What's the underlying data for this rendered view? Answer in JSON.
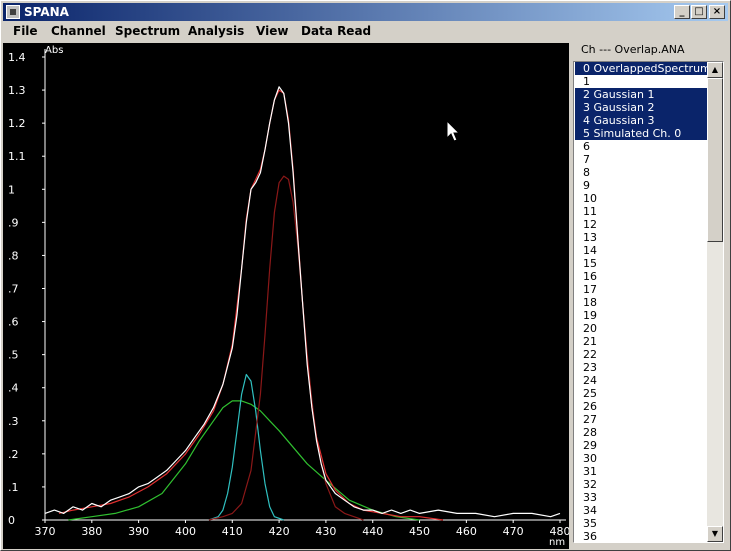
{
  "window": {
    "title": "SPANA"
  },
  "menu": [
    "File",
    "Channel",
    "Spectrum",
    "Analysis",
    "View",
    "Data Read"
  ],
  "title_buttons": {
    "minimize": "_",
    "maximize": "□",
    "close": "×"
  },
  "panel": {
    "label": "Ch --- Overlap.ANA",
    "items": [
      {
        "label": "0 OverlappedSpectrum",
        "selected": true
      },
      {
        "label": "1",
        "selected": false
      },
      {
        "label": "2 Gaussian 1",
        "selected": true
      },
      {
        "label": "3 Gaussian 2",
        "selected": true
      },
      {
        "label": "4 Gaussian 3",
        "selected": true
      },
      {
        "label": "5 Simulated Ch. 0",
        "selected": true
      },
      {
        "label": "6",
        "selected": false
      },
      {
        "label": "7",
        "selected": false
      },
      {
        "label": "8",
        "selected": false
      },
      {
        "label": "9",
        "selected": false
      },
      {
        "label": "10",
        "selected": false
      },
      {
        "label": "11",
        "selected": false
      },
      {
        "label": "12",
        "selected": false
      },
      {
        "label": "13",
        "selected": false
      },
      {
        "label": "14",
        "selected": false
      },
      {
        "label": "15",
        "selected": false
      },
      {
        "label": "16",
        "selected": false
      },
      {
        "label": "17",
        "selected": false
      },
      {
        "label": "18",
        "selected": false
      },
      {
        "label": "19",
        "selected": false
      },
      {
        "label": "20",
        "selected": false
      },
      {
        "label": "21",
        "selected": false
      },
      {
        "label": "22",
        "selected": false
      },
      {
        "label": "23",
        "selected": false
      },
      {
        "label": "24",
        "selected": false
      },
      {
        "label": "25",
        "selected": false
      },
      {
        "label": "26",
        "selected": false
      },
      {
        "label": "27",
        "selected": false
      },
      {
        "label": "28",
        "selected": false
      },
      {
        "label": "29",
        "selected": false
      },
      {
        "label": "30",
        "selected": false
      },
      {
        "label": "31",
        "selected": false
      },
      {
        "label": "32",
        "selected": false
      },
      {
        "label": "33",
        "selected": false
      },
      {
        "label": "34",
        "selected": false
      },
      {
        "label": "35",
        "selected": false
      },
      {
        "label": "36",
        "selected": false
      }
    ]
  },
  "chart_data": {
    "type": "line",
    "ylabel": "Abs",
    "xlabel": "nm",
    "xlim": [
      370,
      480
    ],
    "ylim": [
      0,
      1.4
    ],
    "xticks": [
      370,
      380,
      390,
      400,
      410,
      420,
      430,
      440,
      450,
      460,
      470,
      480
    ],
    "yticks": [
      {
        "v": 0,
        "label": "0"
      },
      {
        "v": 0.1,
        "label": ".1"
      },
      {
        "v": 0.2,
        "label": ".2"
      },
      {
        "v": 0.3,
        "label": ".3"
      },
      {
        "v": 0.4,
        "label": ".4"
      },
      {
        "v": 0.5,
        "label": ".5"
      },
      {
        "v": 0.6,
        "label": ".6"
      },
      {
        "v": 0.7,
        "label": ".7"
      },
      {
        "v": 0.8,
        "label": ".8"
      },
      {
        "v": 0.9,
        "label": ".9"
      },
      {
        "v": 1.0,
        "label": "1"
      },
      {
        "v": 1.1,
        "label": "1.1"
      },
      {
        "v": 1.2,
        "label": "1.2"
      },
      {
        "v": 1.3,
        "label": "1.3"
      },
      {
        "v": 1.4,
        "label": "1.4"
      }
    ],
    "series": [
      {
        "color": "#ffffff",
        "x": [
          370,
          372,
          374,
          376,
          378,
          380,
          382,
          384,
          386,
          388,
          390,
          392,
          394,
          396,
          398,
          400,
          402,
          404,
          406,
          408,
          410,
          411,
          412,
          413,
          414,
          415,
          416,
          417,
          418,
          419,
          420,
          421,
          422,
          423,
          424,
          425,
          426,
          427,
          428,
          429,
          430,
          432,
          434,
          436,
          438,
          440,
          442,
          444,
          446,
          448,
          450,
          454,
          458,
          462,
          466,
          470,
          474,
          478,
          480
        ],
        "y": [
          0.02,
          0.03,
          0.02,
          0.04,
          0.03,
          0.05,
          0.04,
          0.06,
          0.07,
          0.08,
          0.1,
          0.11,
          0.13,
          0.15,
          0.18,
          0.21,
          0.25,
          0.29,
          0.34,
          0.41,
          0.52,
          0.62,
          0.76,
          0.9,
          1.0,
          1.02,
          1.05,
          1.12,
          1.2,
          1.27,
          1.31,
          1.29,
          1.2,
          1.05,
          0.85,
          0.66,
          0.47,
          0.34,
          0.24,
          0.17,
          0.12,
          0.08,
          0.06,
          0.04,
          0.03,
          0.03,
          0.02,
          0.03,
          0.02,
          0.03,
          0.02,
          0.03,
          0.02,
          0.02,
          0.01,
          0.02,
          0.02,
          0.01,
          0.02
        ]
      },
      {
        "color": "#e03030",
        "x": [
          373,
          376,
          380,
          384,
          388,
          392,
          396,
          400,
          403,
          406,
          408,
          410,
          412,
          413,
          414,
          415,
          416,
          417,
          418,
          419,
          420,
          421,
          422,
          423,
          424,
          425,
          426,
          427,
          428,
          430,
          432,
          435,
          438,
          442,
          446,
          450,
          455
        ],
        "y": [
          0.02,
          0.03,
          0.04,
          0.05,
          0.07,
          0.1,
          0.14,
          0.2,
          0.26,
          0.33,
          0.41,
          0.53,
          0.76,
          0.91,
          1.0,
          1.03,
          1.06,
          1.12,
          1.2,
          1.27,
          1.3,
          1.29,
          1.21,
          1.06,
          0.86,
          0.66,
          0.48,
          0.34,
          0.25,
          0.14,
          0.09,
          0.05,
          0.03,
          0.02,
          0.01,
          0.01,
          0.0
        ]
      },
      {
        "color": "#8b1818",
        "x": [
          405,
          408,
          410,
          412,
          414,
          416,
          417,
          418,
          419,
          420,
          421,
          422,
          423,
          424,
          425,
          426,
          427,
          428,
          429,
          430,
          432,
          434,
          436,
          438
        ],
        "y": [
          0.0,
          0.01,
          0.02,
          0.05,
          0.15,
          0.38,
          0.56,
          0.76,
          0.93,
          1.02,
          1.04,
          1.03,
          0.96,
          0.83,
          0.66,
          0.5,
          0.36,
          0.25,
          0.17,
          0.11,
          0.04,
          0.02,
          0.01,
          0.0
        ]
      },
      {
        "color": "#30c0c0",
        "x": [
          405,
          407,
          408,
          409,
          410,
          411,
          412,
          413,
          414,
          415,
          416,
          417,
          418,
          419,
          421
        ],
        "y": [
          0.0,
          0.01,
          0.03,
          0.08,
          0.16,
          0.27,
          0.38,
          0.44,
          0.42,
          0.33,
          0.21,
          0.11,
          0.04,
          0.01,
          0.0
        ]
      },
      {
        "color": "#30c030",
        "x": [
          375,
          380,
          385,
          390,
          395,
          400,
          403,
          406,
          408,
          410,
          412,
          414,
          416,
          418,
          420,
          423,
          426,
          430,
          435,
          440,
          445,
          450
        ],
        "y": [
          0.0,
          0.01,
          0.02,
          0.04,
          0.08,
          0.17,
          0.24,
          0.3,
          0.34,
          0.36,
          0.36,
          0.35,
          0.33,
          0.3,
          0.27,
          0.22,
          0.17,
          0.12,
          0.06,
          0.03,
          0.01,
          0.0
        ]
      }
    ]
  }
}
